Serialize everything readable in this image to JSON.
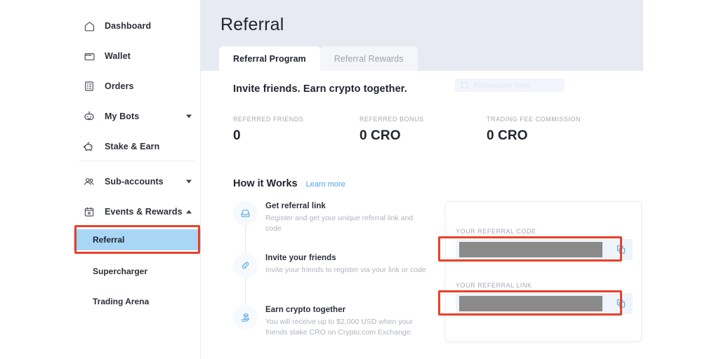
{
  "sidebar": {
    "items": [
      {
        "label": "Dashboard",
        "icon": "home-icon",
        "chevron": "none"
      },
      {
        "label": "Wallet",
        "icon": "wallet-icon",
        "chevron": "none"
      },
      {
        "label": "Orders",
        "icon": "orders-icon",
        "chevron": "none"
      },
      {
        "label": "My Bots",
        "icon": "robot-icon",
        "chevron": "down"
      },
      {
        "label": "Stake & Earn",
        "icon": "piggy-bank-icon",
        "chevron": "none"
      },
      {
        "label": "Sub-accounts",
        "icon": "users-icon",
        "chevron": "down"
      },
      {
        "label": "Events & Rewards",
        "icon": "calendar-icon",
        "chevron": "up"
      }
    ],
    "sub_items": [
      {
        "label": "Referral",
        "active": true
      },
      {
        "label": "Supercharger",
        "active": false
      },
      {
        "label": "Trading Arena",
        "active": false
      }
    ]
  },
  "header": {
    "title": "Referral"
  },
  "tabs": [
    {
      "label": "Referral Program",
      "active": true
    },
    {
      "label": "Referral Rewards",
      "active": false
    }
  ],
  "main": {
    "invite_heading": "Invite friends. Earn crypto together.",
    "snip_overlay": "Rectangular Snip",
    "stats": [
      {
        "label": "REFERRED FRIENDS",
        "value": "0"
      },
      {
        "label": "REFERRED BONUS",
        "value": "0 CRO"
      },
      {
        "label": "TRADING FEE COMMISSION",
        "value": "0 CRO"
      }
    ],
    "how_it_works": {
      "title": "How it Works",
      "learn_more": "Learn more",
      "steps": [
        {
          "icon": "inbox-icon",
          "title": "Get referral link",
          "desc": "Register and get your unique referral link and code"
        },
        {
          "icon": "link-icon",
          "title": "Invite your friends",
          "desc": "Invite your friends to register via your link or code"
        },
        {
          "icon": "coins-hand-icon",
          "title": "Earn crypto together",
          "desc": "You will receive up to $2,000 USD when your friends stake CRO on Crypto.com Exchange."
        }
      ]
    },
    "referral_card": {
      "code_label": "YOUR REFERRAL CODE",
      "code_value": "",
      "link_label": "YOUR REFERRAL LINK",
      "link_value": "",
      "copy_icon": "copy-icon"
    }
  },
  "colors": {
    "accent_blue": "#5aa9e6",
    "annotation_red": "#e8412a",
    "active_highlight": "#aad6f5",
    "header_band": "#e7eaf2",
    "redaction_gray": "#8a8a8a",
    "input_bg": "#eef4fa"
  }
}
